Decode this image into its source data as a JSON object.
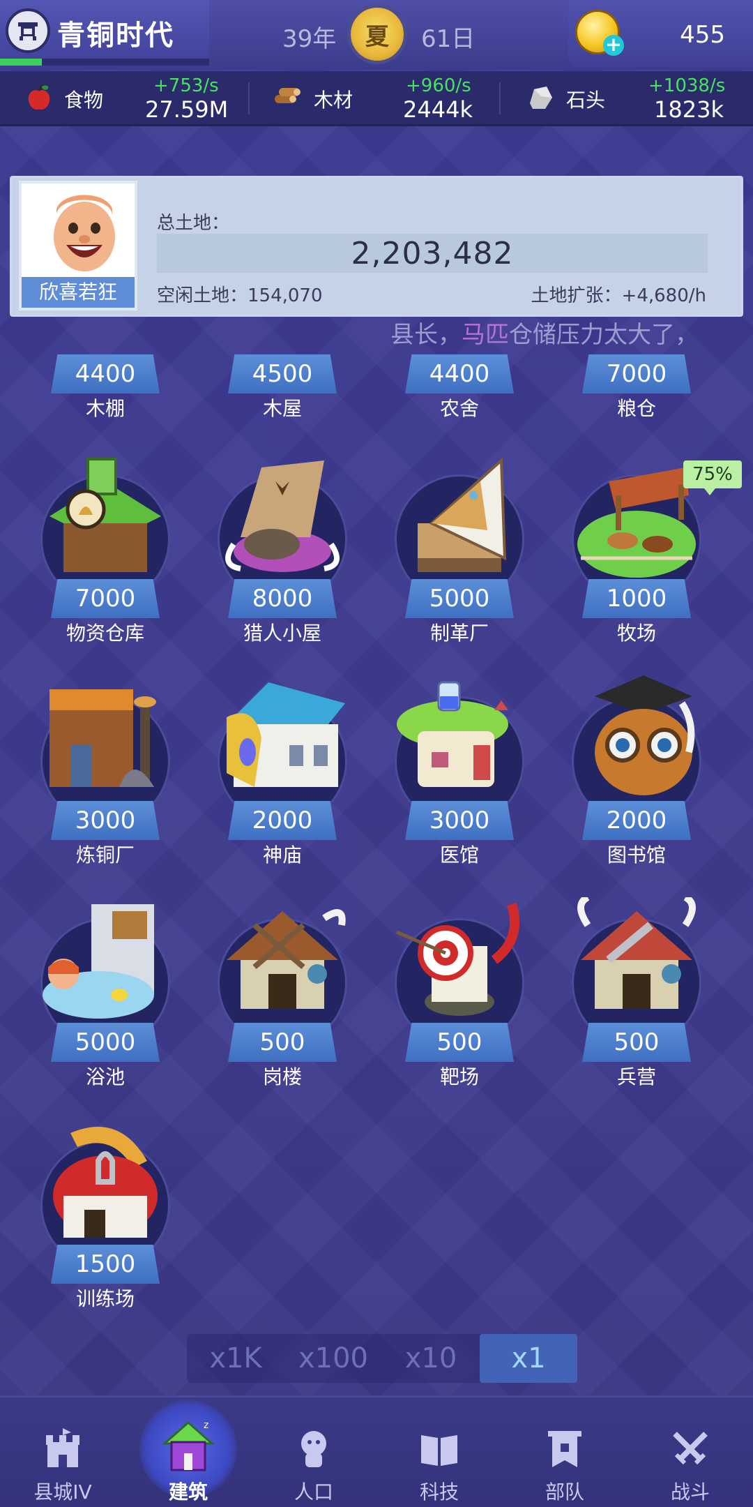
{
  "header": {
    "era_title": "青铜时代",
    "era_progress": 0.2,
    "year": "39年",
    "season": "夏",
    "day": "61日",
    "coins": "455"
  },
  "resources": [
    {
      "name": "食物",
      "rate": "+753/s",
      "total": "27.59M",
      "icon": "apple-icon"
    },
    {
      "name": "木材",
      "rate": "+960/s",
      "total": "2444k",
      "icon": "wood-icon"
    },
    {
      "name": "石头",
      "rate": "+1038/s",
      "total": "1823k",
      "icon": "stone-icon"
    }
  ],
  "land": {
    "avatar_name": "欣喜若狂",
    "total_label": "总土地：",
    "total_value": "2,203,482",
    "free_label": "空闲土地：154,070",
    "expansion_label": "土地扩张：+4,680/h"
  },
  "scroll_message": {
    "part1": "县长，",
    "highlight": "马匹",
    "part2": "仓储压力太大了，"
  },
  "buildings": [
    {
      "name": "木棚",
      "cost": "4400"
    },
    {
      "name": "木屋",
      "cost": "4500"
    },
    {
      "name": "农舍",
      "cost": "4400"
    },
    {
      "name": "粮仓",
      "cost": "7000"
    },
    {
      "name": "物资仓库",
      "cost": "7000"
    },
    {
      "name": "猎人小屋",
      "cost": "8000"
    },
    {
      "name": "制革厂",
      "cost": "5000"
    },
    {
      "name": "牧场",
      "cost": "1000"
    },
    {
      "name": "炼铜厂",
      "cost": "3000"
    },
    {
      "name": "神庙",
      "cost": "2000"
    },
    {
      "name": "医馆",
      "cost": "3000"
    },
    {
      "name": "图书馆",
      "cost": "2000"
    },
    {
      "name": "浴池",
      "cost": "5000"
    },
    {
      "name": "岗楼",
      "cost": "500"
    },
    {
      "name": "靶场",
      "cost": "500"
    },
    {
      "name": "兵营",
      "cost": "500"
    },
    {
      "name": "训练场",
      "cost": "1500"
    }
  ],
  "pasture_badge": "75%",
  "multipliers": [
    "x1K",
    "x100",
    "x10",
    "x1"
  ],
  "multiplier_selected": "x1",
  "nav": [
    {
      "label": "县城IV",
      "icon": "castle-icon"
    },
    {
      "label": "建筑",
      "icon": "house-icon"
    },
    {
      "label": "人口",
      "icon": "person-icon"
    },
    {
      "label": "科技",
      "icon": "book-icon"
    },
    {
      "label": "部队",
      "icon": "banner-icon"
    },
    {
      "label": "战斗",
      "icon": "swords-icon"
    }
  ],
  "colors": {
    "background": "#3d3a8f",
    "rate_green": "#46e35f",
    "cost_blue": "#4f7fce",
    "nav_active": "#5b69e6"
  }
}
